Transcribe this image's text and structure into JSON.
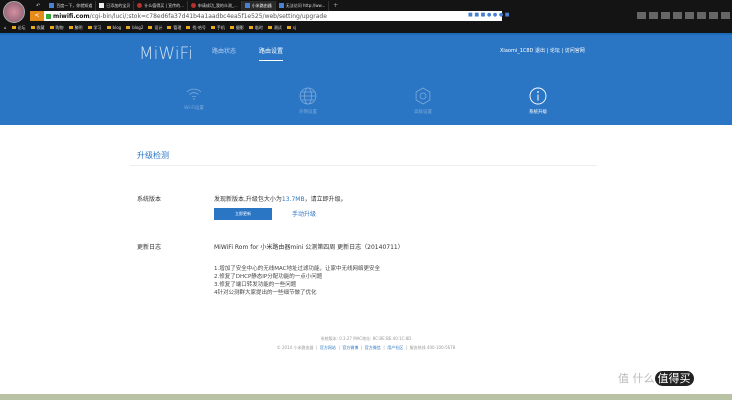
{
  "browser": {
    "tabs": [
      {
        "label": "百度一下，你就知道",
        "icon": "page-icon"
      },
      {
        "label": "已添加的宝贝",
        "icon": "doc-icon"
      },
      {
        "label": "什么值得买 | 宣传的...",
        "icon": "smzdm-icon"
      },
      {
        "label": "申请成功_我的众测_...",
        "icon": "smzdm-icon"
      },
      {
        "label": "小米路由器",
        "icon": "page-icon",
        "active": true
      },
      {
        "label": "无法访问 http://ww...",
        "icon": "page-icon"
      }
    ],
    "url_host": "miwifi.com",
    "url_path": "/cgi-bin/luci/;stok=c78ed6fa37d41b4a1aadbc4ea5f1e525/web/setting/upgrade",
    "bookmarks": [
      "论坛",
      "收藏",
      "购物",
      "聚明",
      "学习",
      "blog",
      "blog2",
      "设计",
      "管理",
      "找-哈号",
      "手机",
      "摄影",
      "临时",
      "测试",
      "sj"
    ]
  },
  "header": {
    "logo": "MiWiFi",
    "nav": [
      "路由状态",
      "路由设置"
    ],
    "user": "Xiaomi_1C8D 退出 | 论坛 | 访问官网"
  },
  "subnav": [
    {
      "label": "Wi-Fi设置",
      "icon": "wifi-icon"
    },
    {
      "label": "外网设置",
      "icon": "globe-icon"
    },
    {
      "label": "高级设置",
      "icon": "gear-icon"
    },
    {
      "label": "系统升级",
      "icon": "info-icon",
      "active": true
    }
  ],
  "main": {
    "title": "升级检测",
    "version_label": "系统版本",
    "version_text_pre": "发现新版本,升级包大小为",
    "version_size": "13.7MB",
    "version_text_post": "，请立即升级。",
    "update_button": "立即更新",
    "manual_link": "手动升级",
    "log_label": "更新日志",
    "log_title": "MiWiFi Rom for 小米路由器mini 公测第四周 更新日志（20140711）",
    "log_items": [
      "1.增加了安全中心的无线MAC地址过滤功能，让家中无线网络更安全",
      "2.修复了DHCP静态IP分配功能的一点小问题",
      "3.修复了端口转发功能的一些问题",
      "4针对公测群大家提出的一些细节做了优化"
    ]
  },
  "footer": {
    "line1": "系统版本: 0.3.27  MAC地址: 8C:BE:BE:40:1C:8D",
    "copyright": "© 2014 小米路由器",
    "links": [
      "官方网站",
      "官方微博",
      "官方微信",
      "用户社区"
    ],
    "hotline": "服务热线 400-100-5678"
  },
  "watermark": {
    "text1": "值",
    "text2": "什么",
    "text3": "值得买"
  }
}
